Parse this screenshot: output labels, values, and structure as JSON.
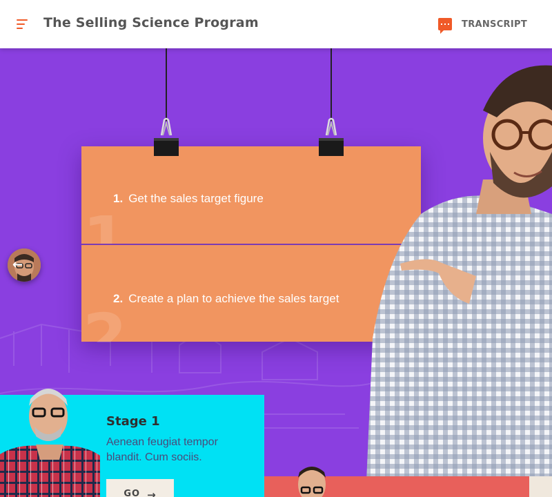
{
  "header": {
    "title": "The Selling Science Program",
    "transcript_label": "TRANSCRIPT"
  },
  "board": {
    "steps": [
      {
        "number": "1.",
        "text": "Get the sales target figure",
        "watermark": "1"
      },
      {
        "number": "2.",
        "text": "Create a plan to achieve the sales target",
        "watermark": "2"
      }
    ]
  },
  "stages": [
    {
      "title": "Stage 1",
      "description": "Aenean feugiat tempor blandit. Cum sociis.",
      "button_label": "GO"
    }
  ],
  "icons": {
    "menu": "hamburger-menu-icon",
    "transcript": "speech-bubble-icon",
    "nav": "arrow-left-icon",
    "go": "arrow-right-icon"
  },
  "colors": {
    "accent": "#f05a28",
    "background": "#8a3fe0",
    "board": "#f19560",
    "stage1_card": "#00e1f4",
    "stage2_card": "#e8605b"
  }
}
